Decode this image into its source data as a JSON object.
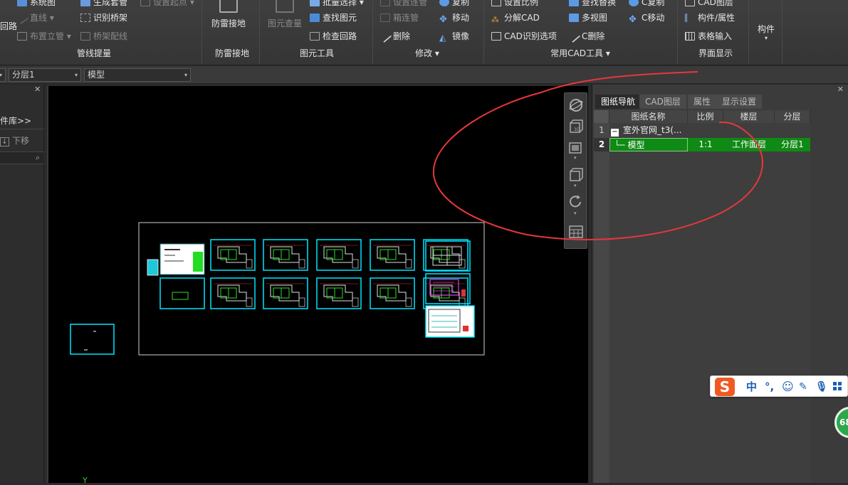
{
  "ribbon": {
    "group1": {
      "items": [
        "系统图",
        "直线",
        "布置立管"
      ],
      "left_partial": "回路",
      "label": "管线提量"
    },
    "group1b": {
      "items": [
        "生成套管",
        "识别桥架",
        "桥架配线"
      ],
      "partial_top": "设置起点"
    },
    "group2": {
      "button": "防雷接地",
      "label": "防雷接地"
    },
    "group3": {
      "big_button": "图元查量",
      "items": [
        "批量选择",
        "查找图元",
        "检查回路"
      ],
      "label": "图元工具"
    },
    "group4": {
      "items_left": [
        "设置连管",
        "箱连管",
        "删除"
      ],
      "items_right": [
        "复制",
        "移动",
        "镜像"
      ],
      "label": "修改"
    },
    "group5": {
      "items_col1": [
        "设置比例",
        "分解CAD",
        "CAD识别选项"
      ],
      "items_col2": [
        "查找替换",
        "多视图",
        "C删除"
      ],
      "items_col3": [
        "C复制",
        "C移动"
      ],
      "label": "常用CAD工具"
    },
    "group6": {
      "items": [
        "CAD图层",
        "构件/属性",
        "表格输入"
      ],
      "label": "界面显示"
    },
    "group7": {
      "label": "构件"
    }
  },
  "dropdowns": {
    "layer": "分层1",
    "view": "模型"
  },
  "left_panel": {
    "library_link": "件库>>",
    "move_down": "下移"
  },
  "canvas": {
    "axis_label": "Y"
  },
  "right_panel": {
    "tabs": [
      "图纸导航",
      "CAD图层",
      "属性",
      "显示设置"
    ],
    "columns": [
      "图纸名称",
      "比例",
      "楼层",
      "分层"
    ],
    "rows": [
      {
        "num": "1",
        "name": "室外官网_t3(...",
        "scale": "",
        "floor": "",
        "layer": ""
      },
      {
        "num": "2",
        "name": "模型",
        "scale": "1:1",
        "floor": "工作面层",
        "layer": "分层1"
      }
    ]
  },
  "ime": {
    "logo": "S",
    "mode": "中",
    "punct": "°,"
  },
  "badge": {
    "value": "68"
  },
  "colors": {
    "cad_cyan": "#00e5ff",
    "cad_green": "#2bdc2b",
    "selected_row": "#0f8a14",
    "annotation": "#e8373a",
    "sogou_orange": "#f05a22"
  }
}
